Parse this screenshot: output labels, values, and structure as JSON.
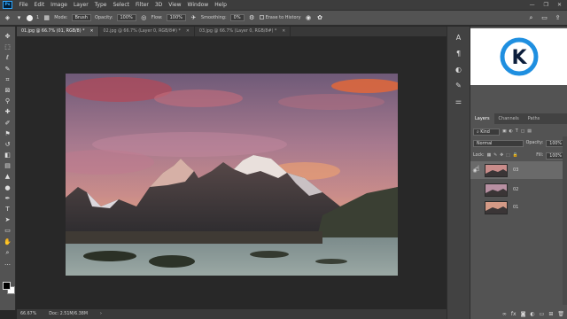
{
  "menubar": {
    "logo": "Ps",
    "items": [
      "File",
      "Edit",
      "Image",
      "Layer",
      "Type",
      "Select",
      "Filter",
      "3D",
      "View",
      "Window",
      "Help"
    ],
    "window_controls": [
      "—",
      "❐",
      "✕"
    ]
  },
  "options": {
    "mode_label": "Mode:",
    "mode_value": "Brush",
    "opacity_label": "Opacity:",
    "opacity_value": "100%",
    "flow_label": "Flow:",
    "flow_value": "100%",
    "smoothing_label": "Smoothing:",
    "smoothing_value": "0%",
    "erase_history_label": "Erase to History",
    "brush_size": "1"
  },
  "tabs": [
    {
      "label": "01.jpg @ 66.7% (01, RGB/8) *",
      "active": true
    },
    {
      "label": "02.jpg @ 66.7% (Layer 0, RGB/8#) *",
      "active": false
    },
    {
      "label": "03.jpg @ 66.7% (Layer 0, RGB/8#) *",
      "active": false
    }
  ],
  "status": {
    "zoom": "66.67%",
    "doc": "Doc: 2.51M/6.38M"
  },
  "layers_panel": {
    "tabs": [
      "Layers",
      "Channels",
      "Paths"
    ],
    "kind_label": "Kind",
    "blend_mode": "Normal",
    "opacity_label": "Opacity:",
    "opacity_value": "100%",
    "lock_label": "Lock:",
    "fill_label": "Fill:",
    "fill_value": "100%",
    "layers": [
      {
        "name": "03",
        "visible": true,
        "selected": true
      },
      {
        "name": "02",
        "visible": false,
        "selected": false
      },
      {
        "name": "01",
        "visible": false,
        "selected": false
      }
    ]
  },
  "logo": {
    "letter": "K",
    "colors": {
      "ring": "#1f8fe0",
      "letter": "#0c1e3c"
    }
  },
  "icons": {
    "tools": [
      "move-tool-icon",
      "marquee-tool-icon",
      "lasso-tool-icon",
      "quick-select-tool-icon",
      "crop-tool-icon",
      "frame-tool-icon",
      "eyedropper-tool-icon",
      "healing-tool-icon",
      "brush-tool-icon",
      "clone-stamp-tool-icon",
      "history-brush-tool-icon",
      "eraser-tool-icon",
      "gradient-tool-icon",
      "blur-tool-icon",
      "dodge-tool-icon",
      "pen-tool-icon",
      "type-tool-icon",
      "path-select-tool-icon",
      "rectangle-tool-icon",
      "hand-tool-icon",
      "zoom-tool-icon",
      "more-tools-icon"
    ]
  }
}
